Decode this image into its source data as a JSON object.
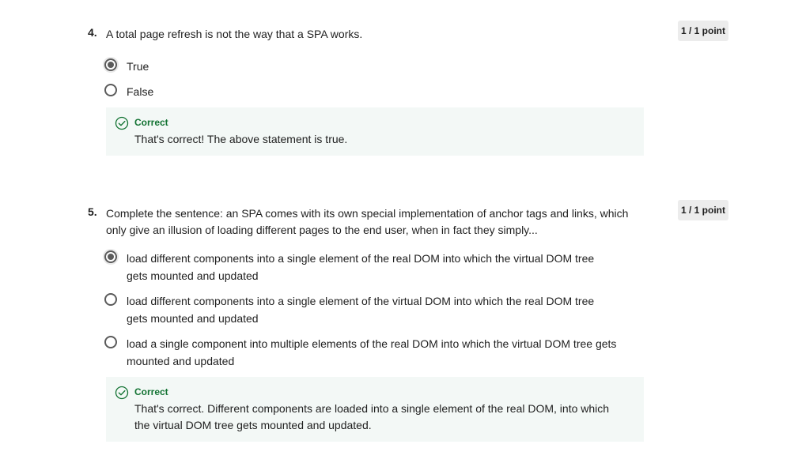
{
  "questions": [
    {
      "number": "4.",
      "text": "A total page refresh is not the way that a SPA works.",
      "points": "1 / 1 point",
      "options": [
        {
          "label": "True",
          "selected": true
        },
        {
          "label": "False",
          "selected": false
        }
      ],
      "feedback": {
        "title": "Correct",
        "text": "That's correct! The above statement is true."
      }
    },
    {
      "number": "5.",
      "text": "Complete the sentence: an SPA comes with its own special implementation of anchor tags and links, which only give an illusion of loading different pages to the end user, when in fact they simply...",
      "points": "1 / 1 point",
      "options": [
        {
          "label": "load different components into a single element of the real DOM into which the virtual DOM tree gets mounted and updated",
          "selected": true
        },
        {
          "label": "load different components into a single element of the virtual DOM into which the real DOM tree gets mounted and updated",
          "selected": false
        },
        {
          "label": "load a single component into multiple elements of the real DOM into which the virtual DOM tree gets mounted and updated",
          "selected": false
        }
      ],
      "feedback": {
        "title": "Correct",
        "text": "That's correct. Different components are loaded into a single element of the real DOM, into which the virtual DOM tree gets mounted and updated."
      }
    }
  ],
  "icons": {
    "correct": "check-circle-icon",
    "correct_color": "#137333"
  }
}
